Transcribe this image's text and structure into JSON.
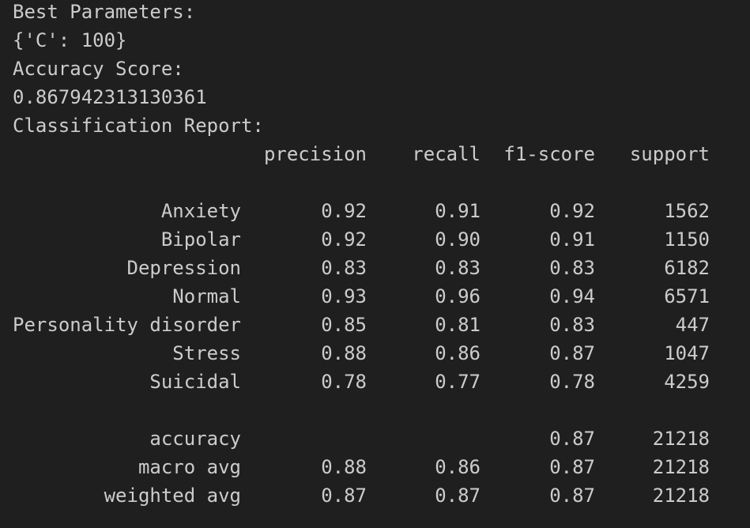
{
  "header": {
    "best_params_label": "Best Parameters:",
    "best_params_value": "{'C': 100}",
    "accuracy_label": "Accuracy Score:",
    "accuracy_value": "0.867942313130361",
    "report_label": "Classification Report:"
  },
  "report": {
    "columns": [
      "precision",
      "recall",
      "f1-score",
      "support"
    ],
    "classes": [
      {
        "label": "Anxiety",
        "precision": "0.92",
        "recall": "0.91",
        "f1": "0.92",
        "support": "1562"
      },
      {
        "label": "Bipolar",
        "precision": "0.92",
        "recall": "0.90",
        "f1": "0.91",
        "support": "1150"
      },
      {
        "label": "Depression",
        "precision": "0.83",
        "recall": "0.83",
        "f1": "0.83",
        "support": "6182"
      },
      {
        "label": "Normal",
        "precision": "0.93",
        "recall": "0.96",
        "f1": "0.94",
        "support": "6571"
      },
      {
        "label": "Personality disorder",
        "precision": "0.85",
        "recall": "0.81",
        "f1": "0.83",
        "support": "447"
      },
      {
        "label": "Stress",
        "precision": "0.88",
        "recall": "0.86",
        "f1": "0.87",
        "support": "1047"
      },
      {
        "label": "Suicidal",
        "precision": "0.78",
        "recall": "0.77",
        "f1": "0.78",
        "support": "4259"
      }
    ],
    "accuracy": {
      "label": "accuracy",
      "f1": "0.87",
      "support": "21218"
    },
    "macro_avg": {
      "label": "macro avg",
      "precision": "0.88",
      "recall": "0.86",
      "f1": "0.87",
      "support": "21218"
    },
    "weighted_avg": {
      "label": "weighted avg",
      "precision": "0.87",
      "recall": "0.87",
      "f1": "0.87",
      "support": "21218"
    }
  }
}
